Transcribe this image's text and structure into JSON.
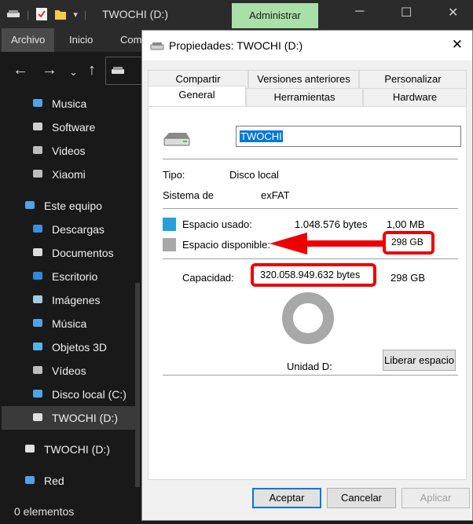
{
  "explorer": {
    "title": "TWOCHI (D:)",
    "admin_tab": "Administrar",
    "ribbon": [
      "Archivo",
      "Inicio",
      "Com"
    ],
    "sidebar": [
      {
        "label": "Musica",
        "icon": "music-icon",
        "color": "#4fa3e8"
      },
      {
        "label": "Software",
        "icon": "keyboard-icon",
        "color": "#cfcfcf"
      },
      {
        "label": "Videos",
        "icon": "film-icon",
        "color": "#bdbdbd"
      },
      {
        "label": "Xiaomi",
        "icon": "phone-icon",
        "color": "#bdbdbd"
      },
      {
        "label": "Este equipo",
        "icon": "computer-icon",
        "color": "#4fa3e8"
      },
      {
        "label": "Descargas",
        "icon": "download-icon",
        "color": "#3d8fe0"
      },
      {
        "label": "Documentos",
        "icon": "document-icon",
        "color": "#dcdcdc"
      },
      {
        "label": "Escritorio",
        "icon": "desktop-icon",
        "color": "#2e8ad8"
      },
      {
        "label": "Imágenes",
        "icon": "image-icon",
        "color": "#9ecbe8"
      },
      {
        "label": "Música",
        "icon": "music-icon",
        "color": "#4fa3e8"
      },
      {
        "label": "Objetos 3D",
        "icon": "cube-icon",
        "color": "#50b8e8"
      },
      {
        "label": "Vídeos",
        "icon": "film-icon",
        "color": "#bdbdbd"
      },
      {
        "label": "Disco local (C:)",
        "icon": "windows-drive-icon",
        "color": "#4fa3e8"
      },
      {
        "label": "TWOCHI (D:)",
        "icon": "drive-icon",
        "color": "#e0e0e0"
      },
      {
        "label": "TWOCHI (D:)",
        "icon": "drive-icon",
        "color": "#e0e0e0"
      },
      {
        "label": "Red",
        "icon": "network-icon",
        "color": "#4fa3e8"
      }
    ],
    "status": "0 elementos"
  },
  "dialog": {
    "title": "Propiedades: TWOCHI (D:)",
    "tabs_top": [
      "Compartir",
      "Versiones anteriores",
      "Personalizar"
    ],
    "tabs_bottom": [
      "General",
      "Herramientas",
      "Hardware"
    ],
    "drive_name": "TWOCHI",
    "type_label": "Tipo:",
    "type_value": "Disco local",
    "fs_label": "Sistema de",
    "fs_value": "exFAT",
    "used_label": "Espacio usado:",
    "used_bytes": "1.048.576 bytes",
    "used_size": "1,00 MB",
    "free_label": "Espacio disponible:",
    "free_size": "298 GB",
    "capacity_label": "Capacidad:",
    "capacity_bytes": "320.058.949.632 bytes",
    "capacity_size": "298 GB",
    "drive_letter": "Unidad D:",
    "free_space_button": "Liberar espacio",
    "ok": "Aceptar",
    "cancel": "Cancelar",
    "apply": "Aplicar",
    "colors": {
      "used": "#26a0da",
      "free": "#a8a8a8",
      "annotation": "#ee0000"
    }
  }
}
